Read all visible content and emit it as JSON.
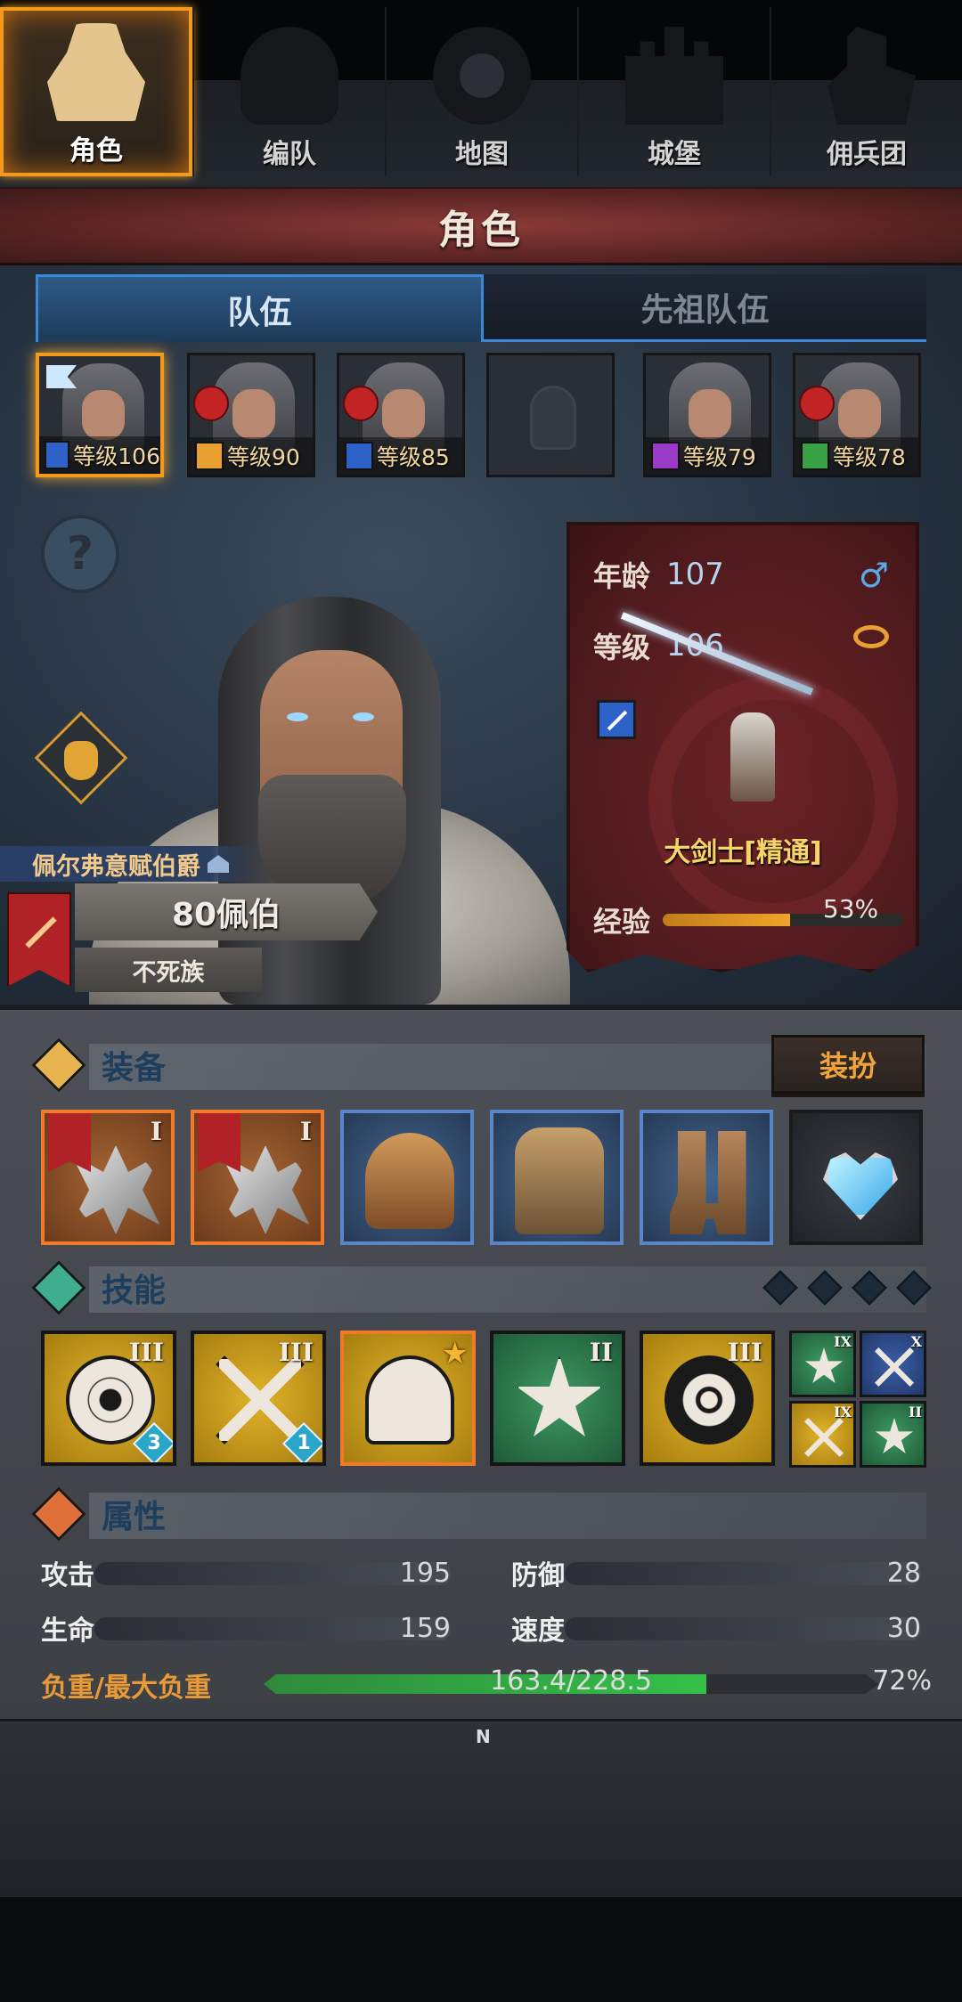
{
  "header": {
    "title": "角色"
  },
  "tabs": [
    {
      "label": "队伍",
      "active": true
    },
    {
      "label": "先祖队伍",
      "active": false
    }
  ],
  "roster": [
    {
      "level_text": "等级106",
      "class_color": "#2d63c8",
      "selected": true,
      "flag": true,
      "red_badge": false
    },
    {
      "level_text": "等级90",
      "class_color": "#e8a030",
      "selected": false,
      "flag": false,
      "red_badge": true
    },
    {
      "level_text": "等级85",
      "class_color": "#2d63c8",
      "selected": false,
      "flag": false,
      "red_badge": true
    },
    {
      "level_text": "",
      "empty": true
    },
    {
      "level_text": "等级79",
      "class_color": "#9a3ac8",
      "selected": false,
      "flag": false,
      "red_badge": false
    },
    {
      "level_text": "等级78",
      "class_color": "#3aa048",
      "selected": false,
      "flag": false,
      "red_badge": true
    }
  ],
  "character": {
    "name": "佩尔弗意赋伯爵",
    "title": "80佩伯",
    "race": "不死族",
    "age_label": "年龄",
    "age": "107",
    "level_label": "等级",
    "level": "106",
    "class_name": "大剑士[精通]",
    "exp_label": "经验",
    "exp_percent_text": "53%",
    "exp_percent": 53
  },
  "equipment": {
    "section_label": "装备",
    "dress_button": "装扮",
    "items": [
      {
        "icon": "axe-icon",
        "tier": "I",
        "rarity": "orange",
        "banner": true
      },
      {
        "icon": "axe-icon",
        "tier": "I",
        "rarity": "orange",
        "banner": true
      },
      {
        "icon": "helmet-icon",
        "tier": "",
        "rarity": "blue",
        "banner": false
      },
      {
        "icon": "armor-icon",
        "tier": "",
        "rarity": "blue",
        "banner": false
      },
      {
        "icon": "boots-icon",
        "tier": "",
        "rarity": "blue",
        "banner": false
      },
      {
        "icon": "heart-amulet-icon",
        "tier": "",
        "rarity": "dark",
        "banner": false
      }
    ]
  },
  "skills": {
    "section_label": "技能",
    "items": [
      {
        "icon": "swirl-icon",
        "tier": "III",
        "color": "gold",
        "count": "3"
      },
      {
        "icon": "crossed-swords-icon",
        "tier": "III",
        "color": "gold",
        "count": "1"
      },
      {
        "icon": "sword-stance-icon",
        "tier": "",
        "color": "gold",
        "star": "★",
        "selected": true
      },
      {
        "icon": "burst-icon",
        "tier": "II",
        "color": "green"
      },
      {
        "icon": "target-icon",
        "tier": "III",
        "color": "gold"
      }
    ],
    "mini": [
      {
        "icon": "burst-icon",
        "tier": "IX",
        "color": "green"
      },
      {
        "icon": "crossed-swords-icon",
        "tier": "X",
        "color": "blue"
      },
      {
        "icon": "crossed-swords-icon",
        "tier": "IX",
        "color": "gold"
      },
      {
        "icon": "burst-icon",
        "tier": "II",
        "color": "green"
      }
    ]
  },
  "attributes": {
    "section_label": "属性",
    "attack_label": "攻击",
    "attack": "195",
    "defense_label": "防御",
    "defense": "28",
    "hp_label": "生命",
    "hp": "159",
    "speed_label": "速度",
    "speed": "30",
    "load_label": "负重/最大负重",
    "load_text": "163.4/228.5",
    "load_percent_text": "72%",
    "load_fraction": 0.72
  },
  "nav": [
    {
      "label": "角色",
      "icon": "knight-icon",
      "active": true
    },
    {
      "label": "编队",
      "icon": "helmet-icon",
      "active": false
    },
    {
      "label": "地图",
      "icon": "compass-map-icon",
      "active": false
    },
    {
      "label": "城堡",
      "icon": "castle-icon",
      "active": false
    },
    {
      "label": "佣兵团",
      "icon": "mercenary-icon",
      "active": false
    }
  ],
  "compass_n": "N",
  "colors": {
    "accent_orange": "#f29a1d",
    "tab_blue": "#3a88d8",
    "title_red": "#5c2524"
  }
}
